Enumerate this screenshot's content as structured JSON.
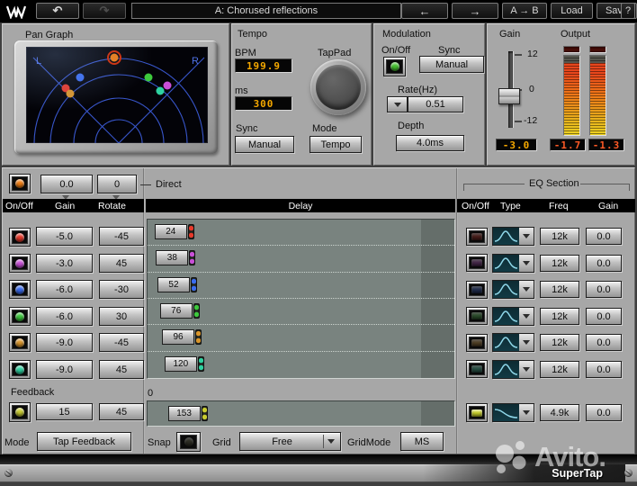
{
  "toolbar": {
    "logo": "waves",
    "undo": "↶",
    "redo": "↷",
    "preset": "A: Chorused reflections",
    "prev": "←",
    "next": "→",
    "ab": "A → B",
    "load": "Load",
    "save": "Save",
    "help": "?"
  },
  "pan_graph": {
    "title": "Pan Graph",
    "left": "L",
    "right": "R",
    "grid_color": "#3b5bd6",
    "label_color": "#5072e6",
    "ring_color": "#d42a00"
  },
  "tempo": {
    "title": "Tempo",
    "bpm_label": "BPM",
    "bpm": "199.9",
    "ms_label": "ms",
    "ms": "300",
    "tappad_label": "TapPad",
    "sync_label": "Sync",
    "sync": "Manual",
    "mode_label": "Mode",
    "mode": "Tempo"
  },
  "modulation": {
    "title": "Modulation",
    "onoff_label": "On/Off",
    "led_color": "#44c32e",
    "sync_label": "Sync",
    "sync": "Manual",
    "rate_label": "Rate(Hz)",
    "rate": "0.51",
    "depth_label": "Depth",
    "depth": "4.0ms"
  },
  "master": {
    "gain_label": "Gain",
    "tick_top": "12",
    "tick_mid": "0",
    "tick_bot": "-12",
    "gain": "-3.0",
    "output_label": "Output",
    "out_left": "-1.7",
    "out_right": "-1.3",
    "amber": "#f5a800",
    "red": "#ff5a26"
  },
  "direct": {
    "color": "#f07d12",
    "gain": "0.0",
    "rotate": "0",
    "label": "Direct"
  },
  "headers": {
    "onoff": "On/Off",
    "gain": "Gain",
    "rotate": "Rotate",
    "delay": "Delay",
    "eq_section": "EQ Section",
    "type": "Type",
    "freq": "Freq"
  },
  "taps": [
    {
      "color": "#e8392a",
      "gain": "-5.0",
      "rotate": "-45",
      "delay": "24",
      "eq_freq": "12k",
      "eq_gain": "0.0"
    },
    {
      "color": "#c94fd8",
      "gain": "-3.0",
      "rotate": "45",
      "delay": "38",
      "eq_freq": "12k",
      "eq_gain": "0.0"
    },
    {
      "color": "#3a6cf0",
      "gain": "-6.0",
      "rotate": "-30",
      "delay": "52",
      "eq_freq": "12k",
      "eq_gain": "0.0"
    },
    {
      "color": "#3dc93d",
      "gain": "-6.0",
      "rotate": "30",
      "delay": "76",
      "eq_freq": "12k",
      "eq_gain": "0.0"
    },
    {
      "color": "#d9952b",
      "gain": "-9.0",
      "rotate": "-45",
      "delay": "96",
      "eq_freq": "12k",
      "eq_gain": "0.0"
    },
    {
      "color": "#2ed2a0",
      "gain": "-9.0",
      "rotate": "45",
      "delay": "120",
      "eq_freq": "12k",
      "eq_gain": "0.0"
    }
  ],
  "feedback": {
    "label": "Feedback",
    "color": "#c8cc30",
    "gain": "15",
    "rotate": "45",
    "zero_label": "0",
    "delay": "153",
    "eq_led_color": "#c8d02a",
    "eq_freq": "4.9k",
    "eq_gain": "0.0"
  },
  "bottom": {
    "mode_label": "Mode",
    "mode": "Tap Feedback",
    "snap_label": "Snap",
    "snap_color": "#6a6a46",
    "grid_label": "Grid",
    "grid": "Free",
    "gridmode_label": "GridMode",
    "gridmode": "MS"
  },
  "footer": {
    "name": "SuperTap"
  },
  "watermark": {
    "text": "Avito."
  }
}
